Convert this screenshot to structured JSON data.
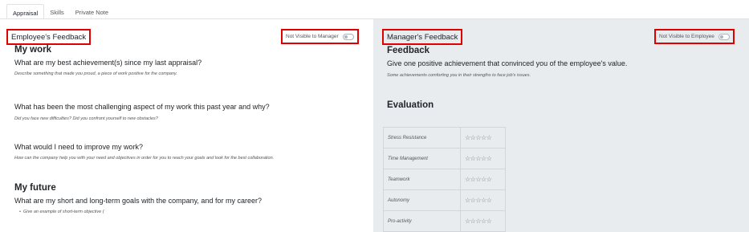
{
  "tabs": [
    {
      "label": "Appraisal",
      "active": true
    },
    {
      "label": "Skills",
      "active": false
    },
    {
      "label": "Private Note",
      "active": false
    }
  ],
  "employee": {
    "section_title": "Employee's Feedback",
    "visibility_label": "Not Visible to Manager",
    "heading_work": "My work",
    "questions": [
      {
        "q": "What are my best achievement(s) since my last appraisal?",
        "hint": "Describe something that made you proud, a piece of work positive for the company."
      },
      {
        "q": "What has been the most challenging aspect of my work this past year and why?",
        "hint": "Did you face new difficulties? Did you confront yourself to new obstacles?"
      },
      {
        "q": "What would I need to improve my work?",
        "hint": "How can the company help you with your need and objectives in order for you to reach your goals and look for the best collaboration."
      }
    ],
    "heading_future": "My future",
    "future_question": "What are my short and long-term goals with the company, and for my career?",
    "future_bullet": "Give an example of short-term objective ("
  },
  "manager": {
    "section_title": "Manager's Feedback",
    "visibility_label": "Not Visible to Employee",
    "heading_feedback": "Feedback",
    "feedback_question": "Give one positive achievement that convinced you of the employee's value.",
    "feedback_hint": "Some achievements comforting you in their strengths to face job's issues.",
    "heading_evaluation": "Evaluation",
    "evaluation": [
      {
        "label": "Stress Resistance",
        "stars": "☆☆☆☆☆"
      },
      {
        "label": "Time Management",
        "stars": "☆☆☆☆☆"
      },
      {
        "label": "Teamwork",
        "stars": "☆☆☆☆☆"
      },
      {
        "label": "Autonomy",
        "stars": "☆☆☆☆☆"
      },
      {
        "label": "Pro-activity",
        "stars": "☆☆☆☆☆"
      }
    ]
  },
  "colors": {
    "highlight": "#e00000",
    "right_panel_bg": "#e9ecef"
  }
}
